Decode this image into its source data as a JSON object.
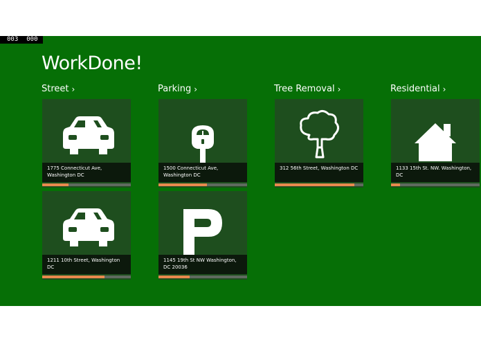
{
  "counter": {
    "left": "003",
    "right": "000"
  },
  "app_title": "WorkDone!",
  "colors": {
    "background": "#066F06",
    "tile": "#1E4E1E",
    "progress": "#E8894E",
    "track": "#5F6A5F"
  },
  "groups": [
    {
      "label": "Street",
      "chevron": "›"
    },
    {
      "label": "Parking",
      "chevron": "›"
    },
    {
      "label": "Tree Removal",
      "chevron": "›"
    },
    {
      "label": "Residential",
      "chevron": "›"
    }
  ],
  "tiles": [
    {
      "icon": "car-icon",
      "address": "1775 Connecticut Ave, Washington DC",
      "progress": 0.3
    },
    {
      "icon": "parking-meter-icon",
      "address": "1500 Connecticut Ave, Washington DC",
      "progress": 0.55
    },
    {
      "icon": "tree-icon",
      "address": "312 56th Street, Washington DC",
      "progress": 0.9
    },
    {
      "icon": "house-icon",
      "address": "1133 15th St. NW. Washington, DC",
      "progress": 0.1
    },
    {
      "icon": "car-icon",
      "address": "1211 10th Street, Washington DC",
      "progress": 0.7
    },
    {
      "icon": "parking-p-icon",
      "address": "1145 19th St NW Washington, DC 20036",
      "progress": 0.35
    }
  ]
}
